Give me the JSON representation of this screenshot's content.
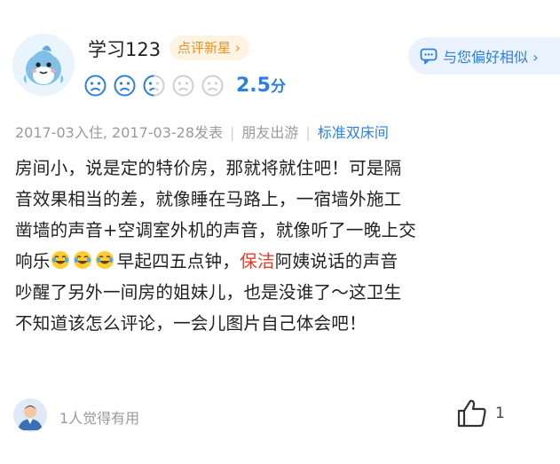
{
  "user": {
    "name": "学习123",
    "badge_label": "点评新星 ›",
    "score": "2.5",
    "score_unit": "分"
  },
  "similar_button_label": "与您偏好相似 ›",
  "meta": {
    "dates": "2017-03入住, 2017-03-28发表",
    "trip_type": "朋友出游",
    "room_type": "标准双床间"
  },
  "review": {
    "line1": "房间小，说是定的特价房，那就将就住吧！可是隔",
    "line2": "音效果相当的差，就像睡在马路上，一宿墙外施工",
    "line3": "凿墙的声音+空调室外机的声音，就像听了一晚上交",
    "line4_a": "响乐",
    "line4_b": "早起四五点钟，",
    "line4_highlight": "保洁",
    "line4_c": "阿姨说话的声音",
    "line5": "吵醒了另外一间房的姐妹儿，也是没谁了～这卫生",
    "line6": "不知道该怎么评论，一会儿图片自己体会吧！"
  },
  "footer": {
    "helpful_text": "1人觉得有用",
    "like_count": "1"
  },
  "colors": {
    "accent": "#2d7fe0",
    "highlight": "#e0402e",
    "badge": "#e8922c"
  }
}
